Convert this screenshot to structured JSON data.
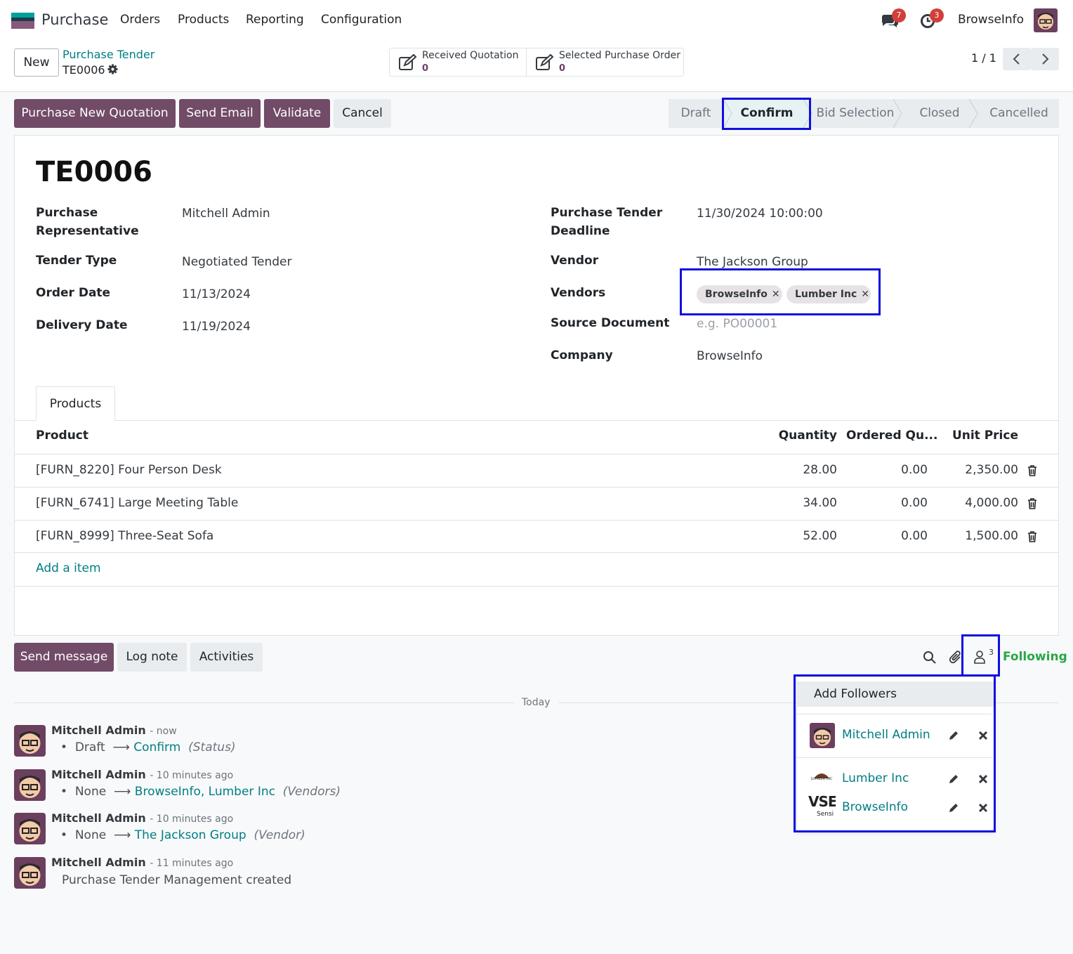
{
  "navbar": {
    "app_name": "Purchase",
    "menu": [
      "Orders",
      "Products",
      "Reporting",
      "Configuration"
    ],
    "messages_badge": "7",
    "activities_badge": "3",
    "company": "BrowseInfo"
  },
  "control_panel": {
    "new_label": "New",
    "breadcrumb": "Purchase Tender",
    "record": "TE0006",
    "smart_buttons": [
      {
        "label": "Received Quotation",
        "value": "0"
      },
      {
        "label": "Selected Purchase Order",
        "value": "0"
      }
    ],
    "pager": "1 / 1"
  },
  "actions": {
    "purchase_new_quotation": "Purchase New Quotation",
    "send_email": "Send Email",
    "validate": "Validate",
    "cancel": "Cancel"
  },
  "statusbar": {
    "stages": [
      "Draft",
      "Confirm",
      "Bid Selection",
      "Closed",
      "Cancelled"
    ],
    "active": "Confirm"
  },
  "form": {
    "title": "TE0006",
    "left": [
      {
        "label": "Purchase Representative",
        "value": "Mitchell Admin"
      },
      {
        "label": "Tender Type",
        "value": "Negotiated Tender"
      },
      {
        "label": "Order Date",
        "value": "11/13/2024"
      },
      {
        "label": "Delivery Date",
        "value": "11/19/2024"
      }
    ],
    "right": {
      "deadline_label": "Purchase Tender Deadline",
      "deadline_value": "11/30/2024 10:00:00",
      "vendor_label": "Vendor",
      "vendor_value": "The Jackson Group",
      "vendors_label": "Vendors",
      "vendors_tags": [
        "BrowseInfo",
        "Lumber Inc"
      ],
      "source_label": "Source Document",
      "source_placeholder": "e.g. PO00001",
      "company_label": "Company",
      "company_value": "BrowseInfo"
    },
    "tab": "Products",
    "table": {
      "headers": [
        "Product",
        "Quantity",
        "Ordered Qu...",
        "Unit Price"
      ],
      "rows": [
        [
          "[FURN_8220] Four Person Desk",
          "28.00",
          "0.00",
          "2,350.00"
        ],
        [
          "[FURN_6741] Large Meeting Table",
          "34.00",
          "0.00",
          "4,000.00"
        ],
        [
          "[FURN_8999] Three-Seat Sofa",
          "52.00",
          "0.00",
          "1,500.00"
        ]
      ],
      "add_item": "Add a item"
    }
  },
  "chatter": {
    "send_message": "Send message",
    "log_note": "Log note",
    "activities": "Activities",
    "followers_count": "3",
    "following": "Following",
    "today": "Today",
    "messages": [
      {
        "author": "Mitchell Admin",
        "time": "- now",
        "old": "Draft",
        "new": "Confirm",
        "field": "(Status)"
      },
      {
        "author": "Mitchell Admin",
        "time": "- 10 minutes ago",
        "old": "None",
        "new": "BrowseInfo, Lumber Inc",
        "field": "(Vendors)"
      },
      {
        "author": "Mitchell Admin",
        "time": "- 10 minutes ago",
        "old": "None",
        "new": "The Jackson Group",
        "field": "(Vendor)"
      },
      {
        "author": "Mitchell Admin",
        "time": "- 11 minutes ago",
        "body": "Purchase Tender Management created"
      }
    ]
  },
  "followers_dropdown": {
    "add_label": "Add Followers",
    "followers": [
      "Mitchell Admin",
      "Lumber Inc",
      "BrowseInfo"
    ],
    "lumber_logo_text": "LUMBER INC",
    "browseinfo_logo_text": "VSE",
    "browseinfo_logo_sub": "Sensi"
  },
  "colors": {
    "brand": "#714b67",
    "link": "#017e84",
    "highlight": "#1010e0",
    "badge": "#d23f3a",
    "following": "#28a745"
  }
}
